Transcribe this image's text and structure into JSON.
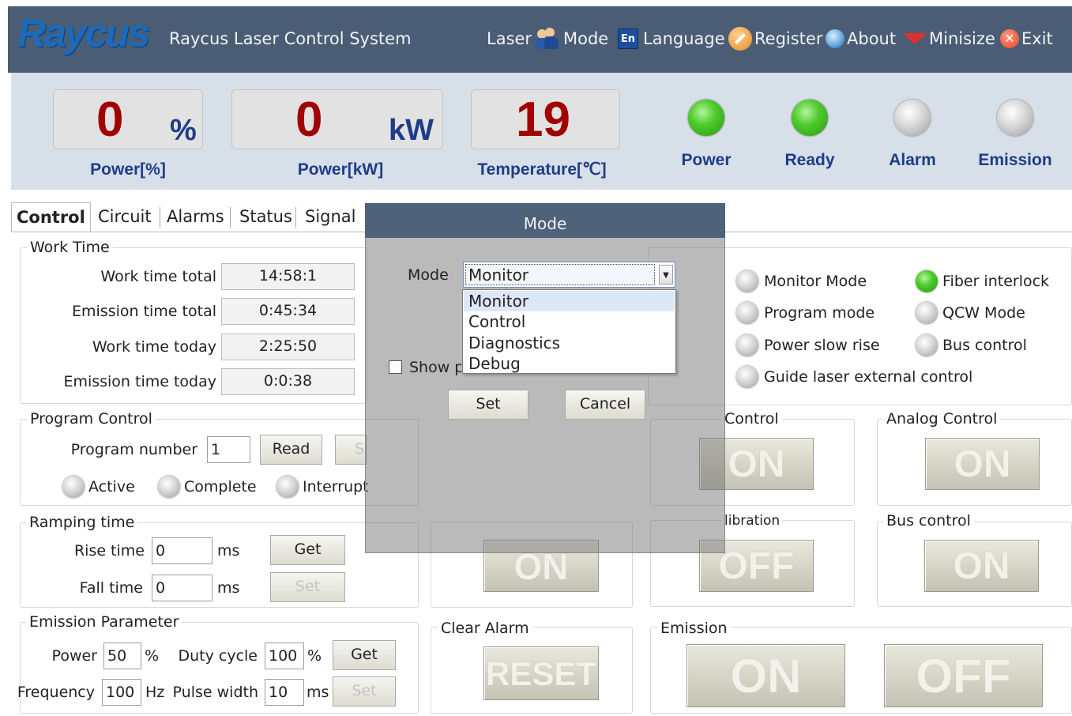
{
  "header": {
    "logo_text": "Raycus",
    "app_title": "Raycus Laser Control System",
    "menu": {
      "laser": "Laser",
      "mode": "Mode",
      "language": "Language",
      "language_badge": "En",
      "register": "Register",
      "about": "About",
      "minimize": "Minisize",
      "exit": "Exit"
    }
  },
  "status": {
    "power_pct": {
      "value": "0",
      "unit": "%",
      "label": "Power[%]"
    },
    "power_kw": {
      "value": "0",
      "unit": "kW",
      "label": "Power[kW]"
    },
    "temperature": {
      "value": "19",
      "label": "Temperature[℃]"
    },
    "indicators": [
      {
        "label": "Power",
        "state": "on"
      },
      {
        "label": "Ready",
        "state": "on"
      },
      {
        "label": "Alarm",
        "state": "off"
      },
      {
        "label": "Emission",
        "state": "off"
      }
    ],
    "colors": {
      "value": "#a00000",
      "label": "#1f3c86",
      "led_on": "#4ecb2c",
      "led_off": "#d6d6d6"
    }
  },
  "tabs": [
    "Control",
    "Circuit",
    "Alarms",
    "Status",
    "Signal"
  ],
  "active_tab": "Control",
  "work_time": {
    "title": "Work Time",
    "rows": [
      {
        "label": "Work time total",
        "value": "14:58:1"
      },
      {
        "label": "Emission time total",
        "value": "0:45:34"
      },
      {
        "label": "Work time today",
        "value": "2:25:50"
      },
      {
        "label": "Emission time today",
        "value": "0:0:38"
      }
    ]
  },
  "program_control": {
    "title": "Program Control",
    "program_number_label": "Program number",
    "program_number": "1",
    "read_label": "Read",
    "set_label_partial": "S",
    "states": {
      "active": "Active",
      "complete": "Complete",
      "interrupt": "Interrupt"
    }
  },
  "ramping": {
    "title": "Ramping time",
    "rise_label": "Rise time",
    "rise_value": "0",
    "fall_label": "Fall time",
    "fall_value": "0",
    "unit": "ms",
    "get_label": "Get",
    "set_label": "Set"
  },
  "emission_param": {
    "title": "Emission Parameter",
    "power_label": "Power",
    "power_value": "50",
    "power_unit": "%",
    "duty_label": "Duty cycle",
    "duty_value": "100",
    "duty_unit": "%",
    "freq_label": "Frequency",
    "freq_value": "100",
    "freq_unit": "Hz",
    "pulse_label": "Pulse width",
    "pulse_value": "10",
    "pulse_unit": "ms",
    "get_label": "Get",
    "set_label": "Set"
  },
  "modes_panel": {
    "items": [
      {
        "label": "Monitor Mode",
        "state": "off"
      },
      {
        "label": "Fiber interlock",
        "state": "on"
      },
      {
        "label": "Program mode",
        "state": "off"
      },
      {
        "label": "QCW Mode",
        "state": "off"
      },
      {
        "label": "Power slow rise",
        "state": "off"
      },
      {
        "label": "Bus control",
        "state": "off"
      },
      {
        "label": "Guide laser external control",
        "state": "off"
      }
    ]
  },
  "control_groups": {
    "control_partial": {
      "title": "Control",
      "button": "ON"
    },
    "analog": {
      "title": "Analog Control",
      "button": "ON"
    },
    "calibration_partial": {
      "title": "libration",
      "button": "OFF"
    },
    "bus": {
      "title": "Bus control",
      "button": "ON"
    },
    "hidden_left_button": "ON",
    "clear_alarm": {
      "title": "Clear Alarm",
      "button": "RESET"
    },
    "emission": {
      "title": "Emission",
      "on": "ON",
      "off": "OFF"
    }
  },
  "dialog": {
    "title": "Mode",
    "mode_label": "Mode",
    "selected": "Monitor",
    "options": [
      "Monitor",
      "Control",
      "Diagnostics",
      "Debug"
    ],
    "highlighted_index": 0,
    "show_checkbox_label_partial": "Show p",
    "set_label": "Set",
    "cancel_label": "Cancel"
  }
}
